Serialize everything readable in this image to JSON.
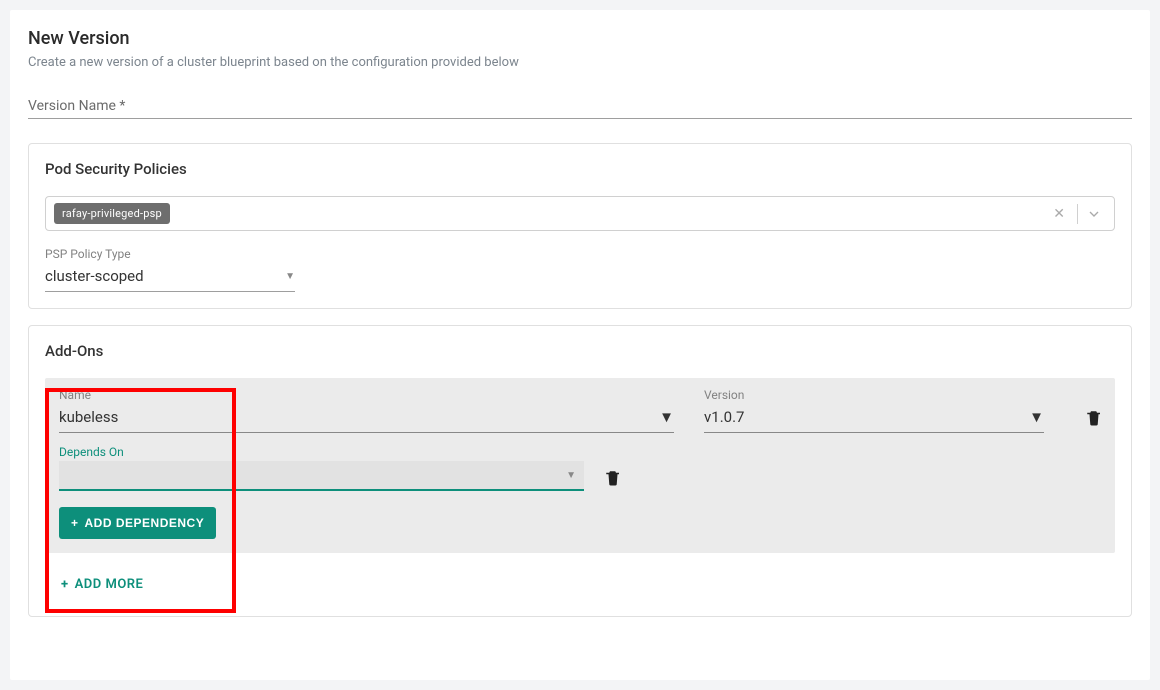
{
  "header": {
    "title": "New Version",
    "subtitle": "Create a new version of a cluster blueprint based on the configuration provided below"
  },
  "version_name": {
    "label": "Version Name *"
  },
  "psp_panel": {
    "title": "Pod Security Policies",
    "chip": "rafay-privileged-psp",
    "policy_type_label": "PSP Policy Type",
    "policy_type_value": "cluster-scoped"
  },
  "addons_panel": {
    "title": "Add-Ons",
    "name_label": "Name",
    "name_value": "kubeless",
    "version_label": "Version",
    "version_value": "v1.0.7",
    "depends_on_label": "Depends On",
    "add_dependency_label": "ADD DEPENDENCY",
    "add_more_label": "ADD MORE"
  }
}
